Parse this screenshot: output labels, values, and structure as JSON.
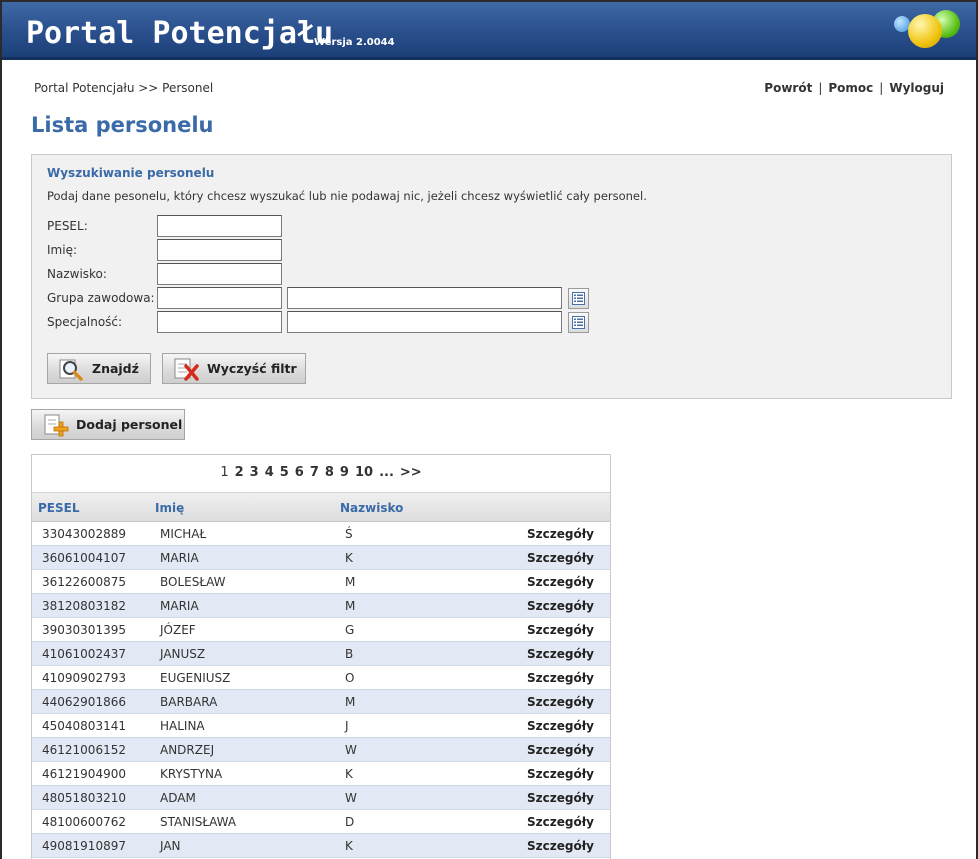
{
  "header": {
    "title": "Portal Potencjału",
    "version": "Wersja 2.0044"
  },
  "breadcrumb": "Portal Potencjału >> Personel",
  "toplinks": {
    "back": "Powrót",
    "help": "Pomoc",
    "logout": "Wyloguj",
    "sep": "|"
  },
  "page_title": "Lista personelu",
  "search": {
    "title": "Wyszukiwanie personelu",
    "description": "Podaj dane pesonelu, który chcesz wyszukać lub nie podawaj nic, jeżeli chcesz wyświetlić cały personel.",
    "labels": {
      "pesel": "PESEL:",
      "imie": "Imię:",
      "nazwisko": "Nazwisko:",
      "grupa": "Grupa zawodowa:",
      "specjalnosc": "Specjalność:"
    },
    "find_label": "Znajdź",
    "clear_label": "Wyczyść filtr"
  },
  "add_label": "Dodaj personel",
  "pager": [
    "1",
    "2",
    "3",
    "4",
    "5",
    "6",
    "7",
    "8",
    "9",
    "10",
    "...",
    ">>"
  ],
  "table": {
    "headers": {
      "pesel": "PESEL",
      "imie": "Imię",
      "nazwisko": "Nazwisko"
    },
    "details_label": "Szczegóły",
    "rows": [
      {
        "pesel": "33043002889",
        "imie": "MICHAŁ",
        "nazwisko": "Ś"
      },
      {
        "pesel": "36061004107",
        "imie": "MARIA",
        "nazwisko": "K"
      },
      {
        "pesel": "36122600875",
        "imie": "BOLESŁAW",
        "nazwisko": "M"
      },
      {
        "pesel": "38120803182",
        "imie": "MARIA",
        "nazwisko": "M"
      },
      {
        "pesel": "39030301395",
        "imie": "JÓZEF",
        "nazwisko": "G"
      },
      {
        "pesel": "41061002437",
        "imie": "JANUSZ",
        "nazwisko": "B"
      },
      {
        "pesel": "41090902793",
        "imie": "EUGENIUSZ",
        "nazwisko": "O"
      },
      {
        "pesel": "44062901866",
        "imie": "BARBARA",
        "nazwisko": "M"
      },
      {
        "pesel": "45040803141",
        "imie": "HALINA",
        "nazwisko": "J"
      },
      {
        "pesel": "46121006152",
        "imie": "ANDRZEJ",
        "nazwisko": "W"
      },
      {
        "pesel": "46121904900",
        "imie": "KRYSTYNA",
        "nazwisko": "K"
      },
      {
        "pesel": "48051803210",
        "imie": "ADAM",
        "nazwisko": "W"
      },
      {
        "pesel": "48100600762",
        "imie": "STANISŁAWA",
        "nazwisko": "D"
      },
      {
        "pesel": "49081910897",
        "imie": "JAN",
        "nazwisko": "K"
      }
    ]
  }
}
